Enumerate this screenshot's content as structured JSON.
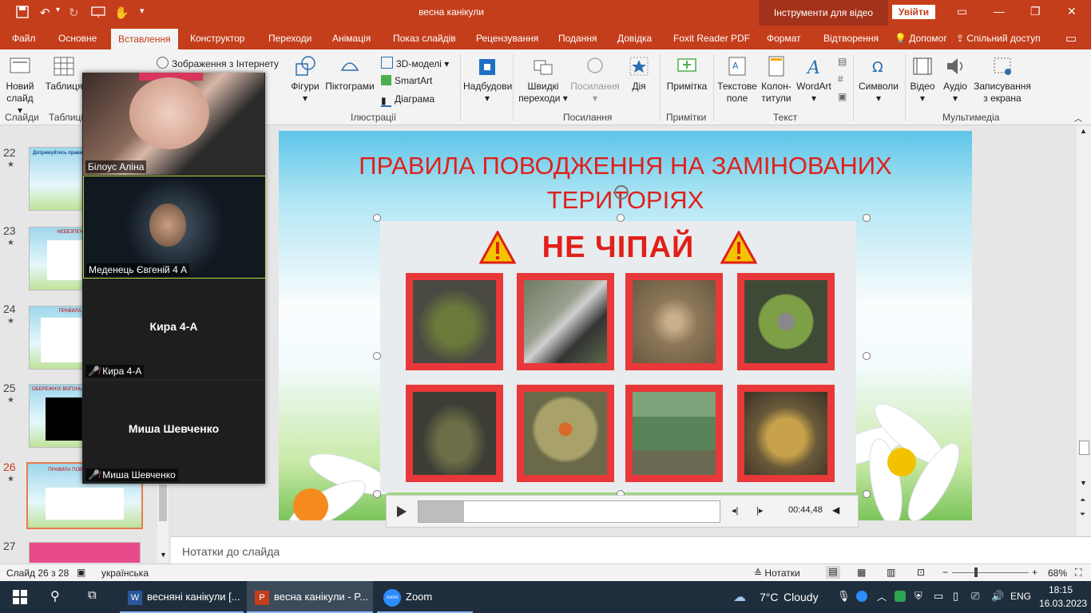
{
  "window": {
    "title": "весна канікули",
    "context_tools": "Інструменти для відео",
    "signin": "Увійти"
  },
  "tabs": [
    "Файл",
    "Основне",
    "Вставлення",
    "Конструктор",
    "Переходи",
    "Анімація",
    "Показ слайдів",
    "Рецензування",
    "Подання",
    "Довідка",
    "Foxit Reader PDF",
    "Формат",
    "Відтворення"
  ],
  "tab_help": "Допомог",
  "tab_share": "Спільний доступ",
  "ribbon": {
    "new_slide": "Новий слайд",
    "table": "Таблиця",
    "online_images": "Зображення з Інтернету",
    "shapes": "Фігури",
    "icons": "Піктограми",
    "models_3d": "3D-моделі",
    "smartart": "SmartArt",
    "chart": "Діаграма",
    "addins": "Надбудови",
    "zoom": "Швидкі переходи",
    "link": "Посилання",
    "action": "Дія",
    "comment": "Примітка",
    "textbox": "Текстове поле",
    "header_footer": "Колон-титули",
    "wordart": "WordArt",
    "symbols": "Символи",
    "video": "Відео",
    "audio": "Аудіо",
    "screen_recording": "Записування з екрана",
    "groups": {
      "slides": "Слайди",
      "tables": "Таблиці",
      "illustrations": "Ілюстрації",
      "links": "Посилання",
      "comments": "Примітки",
      "text": "Текст",
      "media": "Мультимедіа"
    }
  },
  "thumbnails": [
    {
      "num": "22",
      "title": "Дотримуйтесь правил пожежної безпеки"
    },
    {
      "num": "23",
      "title": "НЕБЕЗПЕЧНІ ЗНАХІДКИ"
    },
    {
      "num": "24",
      "title": "ПРАВИЛА ТАБЕЗПЕКИ"
    },
    {
      "num": "25",
      "title": "ОБЕРЕЖНО! ВОГОНЬ!"
    },
    {
      "num": "26",
      "title": "ПРАВИЛА ПОВОДЖЕННЯ ТЕРИ"
    },
    {
      "num": "27",
      "title": ""
    }
  ],
  "zoom": {
    "participants": [
      {
        "name": "Білоус Аліна"
      },
      {
        "name": "Меденець Євгеній 4 А"
      },
      {
        "name": "Кира 4-А",
        "label": "Кира 4-А"
      },
      {
        "name": "Миша Шевченко",
        "label": "Миша Шевченко"
      }
    ]
  },
  "slide": {
    "title": "ПРАВИЛА ПОВОДЖЕННЯ НА ЗАМІНОВАНИХ ТЕРИТОРІЯХ",
    "warning_text": "НЕ ЧІПАЙ"
  },
  "player": {
    "time": "00:44,48",
    "progress": 0.15
  },
  "notes_placeholder": "Нотатки до слайда",
  "status": {
    "slide_of": "Слайд 26 з 28",
    "language": "українська",
    "notes_btn": "Нотатки",
    "zoom": "68%"
  },
  "taskbar": {
    "app1": "весняні канікули [...",
    "app2": "весна канікули - P...",
    "app3": "Zoom",
    "weather_temp": "7°C",
    "weather_desc": "Cloudy",
    "lang": "ENG",
    "time": "18:15",
    "date": "16.03.2023"
  },
  "colors": {
    "accent": "#c43e1c",
    "slide_title": "#e0201a",
    "cell_border": "#e8383a"
  }
}
